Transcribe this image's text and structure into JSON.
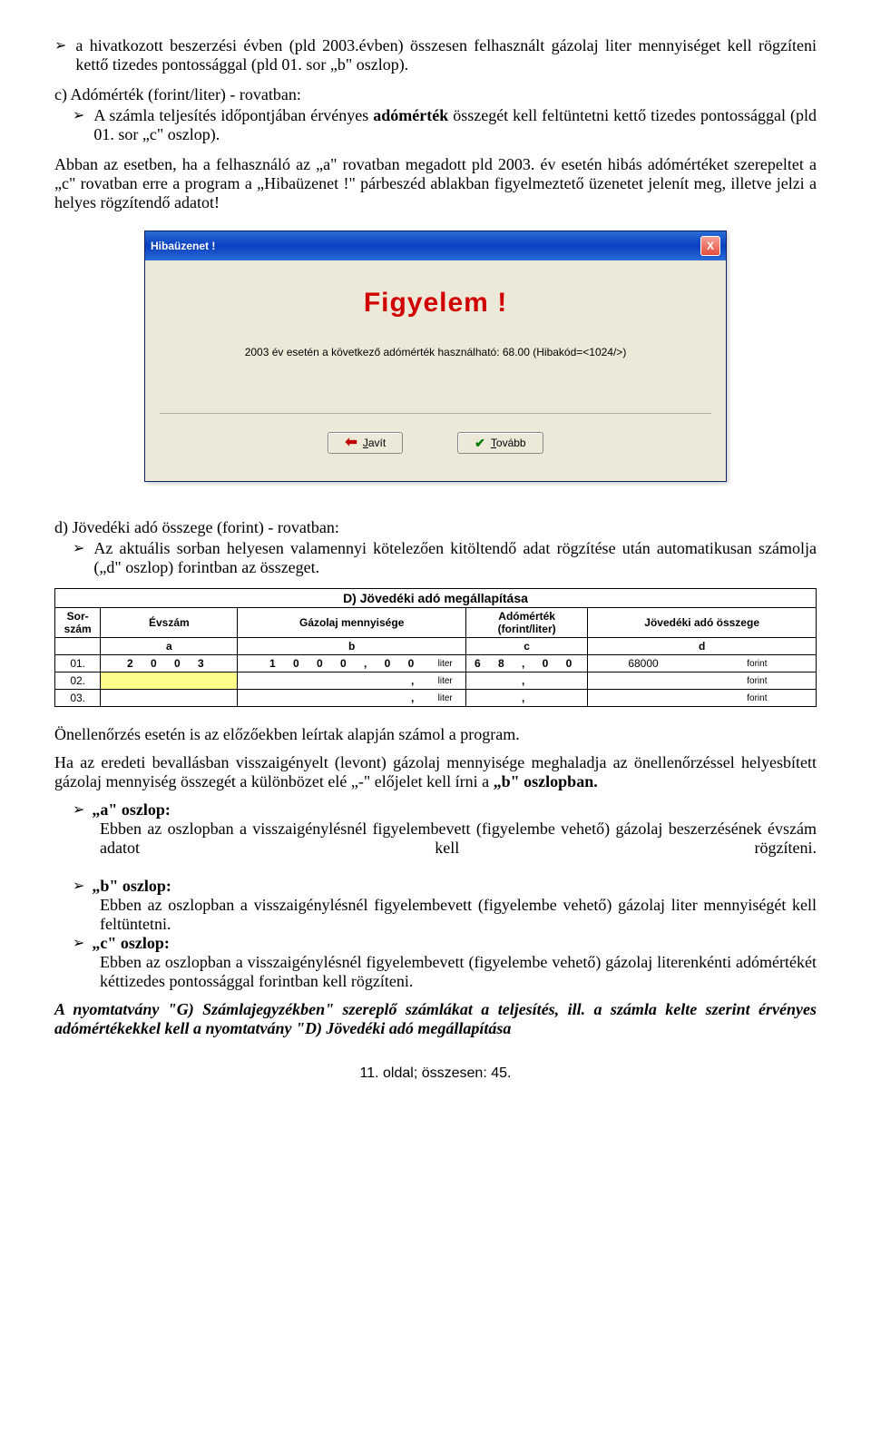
{
  "intro_bullet": "a hivatkozott beszerzési évben (pld 2003.évben) összesen felhasznált gázolaj liter mennyiséget kell rögzíteni kettő tizedes pontossággal (pld 01. sor „b\" oszlop).",
  "section_c_title": "c) Adómérték (forint/liter) - rovatban:",
  "section_c_bullet_pre": "A számla teljesítés időpontjában érvényes ",
  "section_c_bullet_bold": "adómérték",
  "section_c_bullet_post": " összegét kell feltüntetni kettő tizedes pontossággal (pld 01. sor „c\" oszlop).",
  "para1": "Abban az esetben, ha a felhasználó az „a\" rovatban megadott pld 2003. év esetén hibás adómértéket szerepeltet a „c\" rovatban erre a program a „Hibaüzenet !\" párbeszéd ablakban figyelmeztető üzenetet jelenít meg, illetve jelzi a helyes rögzítendő adatot!",
  "dialog": {
    "title": "Hibaüzenet !",
    "close": "X",
    "headline": "Figyelem !",
    "msg": "2003 év esetén a következő adómérték használható: 68.00 (Hibakód=<1024/>)",
    "btn_javit": "Javít",
    "btn_tovabb": "Tovább"
  },
  "section_d_title": "d) Jövedéki adó összege (forint) - rovatban:",
  "section_d_bullet": "Az aktuális sorban helyesen valamennyi kötelezően kitöltendő adat rögzítése után automatikusan számolja („d\" oszlop) forintban az összeget.",
  "table": {
    "title": "D) Jövedéki adó megállapítása",
    "h_sor": "Sor-szám",
    "h_ev": "Évszám",
    "h_gaz": "Gázolaj mennyisége",
    "h_ado_l1": "Adómérték",
    "h_ado_l2": "(forint/liter)",
    "h_joved": "Jövedéki adó összege",
    "sub_a": "a",
    "sub_b": "b",
    "sub_c": "c",
    "sub_d": "d",
    "r1_sor": "01.",
    "r1_ev": "2 0 0 3",
    "r1_gaz": "1 0 0 0 , 0 0",
    "r1_ado": "6 8 , 0 0",
    "r1_joved": "68000",
    "r2_sor": "02.",
    "r3_sor": "03.",
    "liter": "liter",
    "forint": "forint",
    "comma": ","
  },
  "para_onell": "Önellenőrzés esetén is az előzőekben leírtak alapján számol a program.",
  "para_ha_pre": "Ha az eredeti bevallásban visszaigényelt (levont) gázolaj mennyisége meghaladja az önellenőrzéssel helyesbített gázolaj mennyiség összegét a különbözet elé „-\" előjelet kell írni a ",
  "para_ha_bold": "„b\" oszlopban.",
  "col_a_label": "„a\" oszlop:",
  "col_a_text": "Ebben az oszlopban a visszaigénylésnél figyelembevett (figyelembe vehető) gázolaj beszerzésének évszám adatot kell rögzíteni.",
  "col_b_label": "„b\" oszlop:",
  "col_b_text": "Ebben az oszlopban a visszaigénylésnél figyelembevett (figyelembe vehető) gázolaj liter mennyiségét kell feltüntetni.",
  "col_c_label": "„c\" oszlop:",
  "col_c_text": "Ebben az oszlopban a visszaigénylésnél figyelembevett (figyelembe vehető) gázolaj literenkénti adómértékét kéttizedes pontossággal forintban kell rögzíteni.",
  "final_italic": "A nyomtatvány \"G) Számlajegyzékben\" szereplő számlákat a teljesítés, ill. a számla kelte szerint érvényes adómértékekkel kell a nyomtatvány \"D) Jövedéki adó megállapítása",
  "footer": "11. oldal; összesen: 45."
}
